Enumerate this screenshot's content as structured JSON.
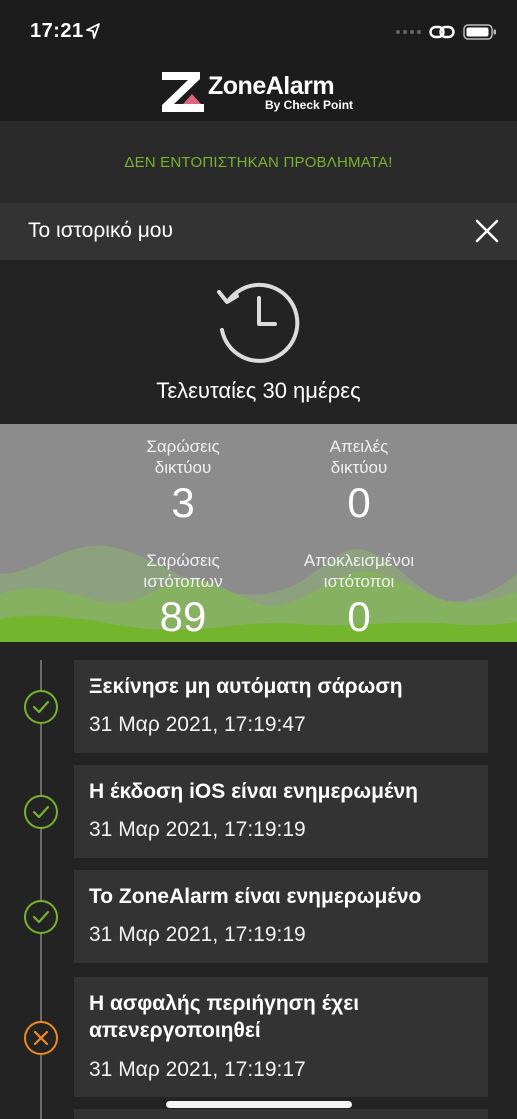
{
  "status_bar": {
    "time": "17:21"
  },
  "header": {
    "logo_word": "ZoneAlarm",
    "logo_sub": "By Check Point"
  },
  "banner": {
    "message": "ΔΕΝ ΕΝΤΟΠΙΣΤΗΚΑΝ ΠΡΟΒΛΗΜΑΤΑ!"
  },
  "section": {
    "title": "Το ιστορικό μου"
  },
  "hero": {
    "period": "Τελευταίες 30 ημέρες"
  },
  "stats": [
    {
      "label_line1": "Σαρώσεις",
      "label_line2": "δικτύου",
      "value": "3"
    },
    {
      "label_line1": "Απειλές",
      "label_line2": "δικτύου",
      "value": "0"
    },
    {
      "label_line1": "Σαρώσεις",
      "label_line2": "ιστότοπων",
      "value": "89"
    },
    {
      "label_line1": "Αποκλεισμένοι",
      "label_line2": "ιστότοποι",
      "value": "0"
    }
  ],
  "events": [
    {
      "title": "Ξεκίνησε μη αυτόματη σάρωση",
      "time": "31 Μαρ 2021, 17:19:47",
      "status": "ok"
    },
    {
      "title": "Η έκδοση iOS είναι ενημερωμένη",
      "time": "31 Μαρ 2021, 17:19:19",
      "status": "ok"
    },
    {
      "title": "Το ZoneAlarm είναι ενημερωμένο",
      "time": "31 Μαρ 2021, 17:19:19",
      "status": "ok"
    },
    {
      "title": "Η ασφαλής περιήγηση έχει απενεργοποιηθεί",
      "time": "31 Μαρ 2021, 17:19:17",
      "status": "warning"
    }
  ],
  "colors": {
    "accent_green": "#78b22f",
    "warning_orange": "#f08a1e",
    "card_bg": "#333333",
    "page_bg": "#232323"
  }
}
